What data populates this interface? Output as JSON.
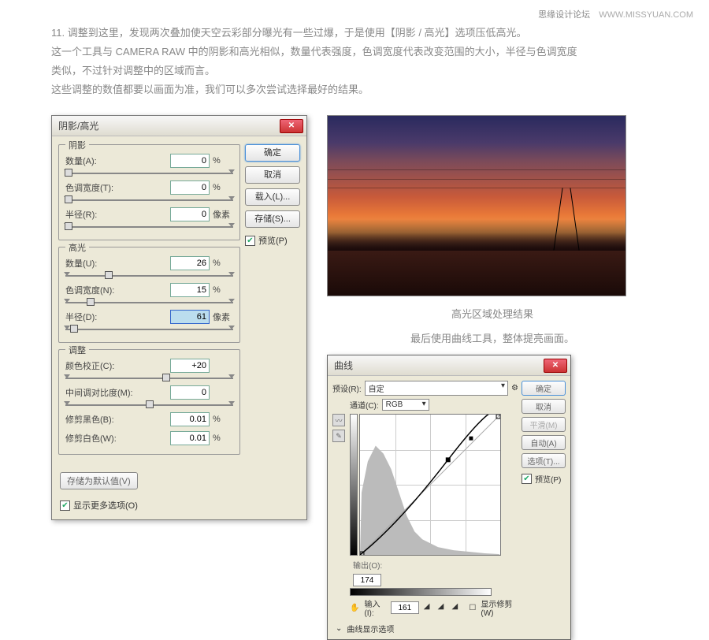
{
  "watermark": {
    "cn": "思缘设计论坛",
    "en": "WWW.MISSYUAN.COM"
  },
  "article": {
    "line1_num": "11. ",
    "line1": "调整到这里，发现两次叠加使天空云彩部分曝光有一些过爆，于是使用【阴影 / 高光】选项压低高光。",
    "line2": "这一个工具与 CAMERA RAW 中的阴影和高光相似，数量代表强度，色调宽度代表改变范围的大小，半径与色调宽度",
    "line3": "类似，不过针对调整中的区域而言。",
    "line4": "这些调整的数值都要以画面为准，我们可以多次尝试选择最好的结果。"
  },
  "shadowsHighlights": {
    "title": "阴影/高光",
    "groups": {
      "shadows": {
        "legend": "阴影",
        "amount": {
          "label": "数量(A):",
          "value": "0",
          "unit": "%"
        },
        "tonalWidth": {
          "label": "色调宽度(T):",
          "value": "0",
          "unit": "%"
        },
        "radius": {
          "label": "半径(R):",
          "value": "0",
          "unit": "像素"
        }
      },
      "highlights": {
        "legend": "高光",
        "amount": {
          "label": "数量(U):",
          "value": "26",
          "unit": "%"
        },
        "tonalWidth": {
          "label": "色调宽度(N):",
          "value": "15",
          "unit": "%"
        },
        "radius": {
          "label": "半径(D):",
          "value": "61",
          "unit": "像素"
        }
      },
      "adjust": {
        "legend": "调整",
        "colorCorrect": {
          "label": "颜色校正(C):",
          "value": "+20",
          "unit": ""
        },
        "midtone": {
          "label": "中间调对比度(M):",
          "value": "0",
          "unit": ""
        },
        "clipBlack": {
          "label": "修剪黑色(B):",
          "value": "0.01",
          "unit": "%"
        },
        "clipWhite": {
          "label": "修剪白色(W):",
          "value": "0.01",
          "unit": "%"
        }
      }
    },
    "buttons": {
      "ok": "确定",
      "cancel": "取消",
      "load": "载入(L)...",
      "save": "存储(S)..."
    },
    "preview": "预览(P)",
    "saveDefaults": "存储为默认值(V)",
    "showMore": "显示更多选项(O)"
  },
  "result": {
    "caption1": "高光区域处理结果",
    "caption2": "最后使用曲线工具，整体提亮画面。"
  },
  "curves": {
    "title": "曲线",
    "presetLabel": "预设(R):",
    "presetValue": "自定",
    "channelLabel": "通道(C):",
    "channelValue": "RGB",
    "outputLabel": "输出(O):",
    "outputValue": "174",
    "inputLabel": "输入(I):",
    "inputValue": "161",
    "showClipLabel": "显示修剪(W)",
    "curveOptionsBtn": "曲线显示选项",
    "buttons": {
      "ok": "确定",
      "cancel": "取消",
      "smooth": "平滑(M)",
      "auto": "自动(A)",
      "options": "选项(T)..."
    },
    "preview": "预览(P)",
    "gearIcon": "⚙"
  }
}
